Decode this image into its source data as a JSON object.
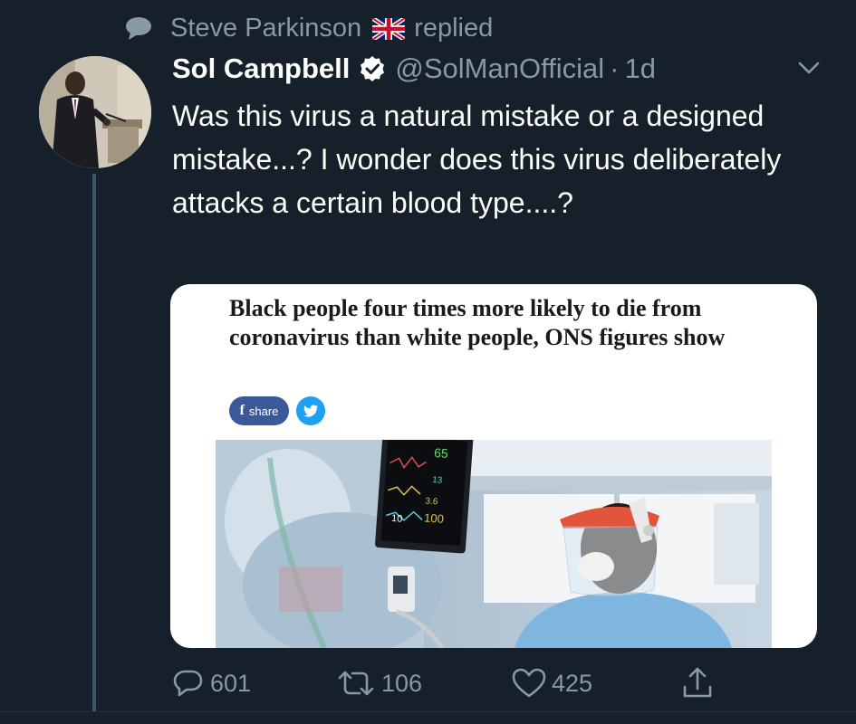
{
  "context": {
    "replier_name": "Steve Parkinson",
    "replied_label": "replied",
    "icon": "speech-bubble-icon",
    "flag_icon": "uk-flag-icon"
  },
  "tweet": {
    "display_name": "Sol Campbell",
    "verified_icon": "verified-badge-icon",
    "handle": "@SolManOfficial",
    "separator": "·",
    "time": "1d",
    "text": "Was this virus a natural mistake or a designed mistake...? I wonder does this virus deliberately attacks a certain blood type....?",
    "menu_icon": "chevron-down-icon"
  },
  "card": {
    "headline": "Black people four times more likely to die from coronavirus than white people, ONS figures show",
    "share_f": "f",
    "share_label": "share",
    "twitter_icon": "twitter-bird-icon",
    "monitor_values": [
      "65",
      "13",
      "3.6",
      "10",
      "100"
    ]
  },
  "actions": {
    "reply_count": "601",
    "retweet_count": "106",
    "like_count": "425",
    "share_icon": "share-icon"
  },
  "colors": {
    "background": "#15202b",
    "text_primary": "#ffffff",
    "text_secondary": "#8899a6",
    "thread_line": "#3d5466",
    "facebook": "#3b5998",
    "twitter": "#1da1f2"
  }
}
